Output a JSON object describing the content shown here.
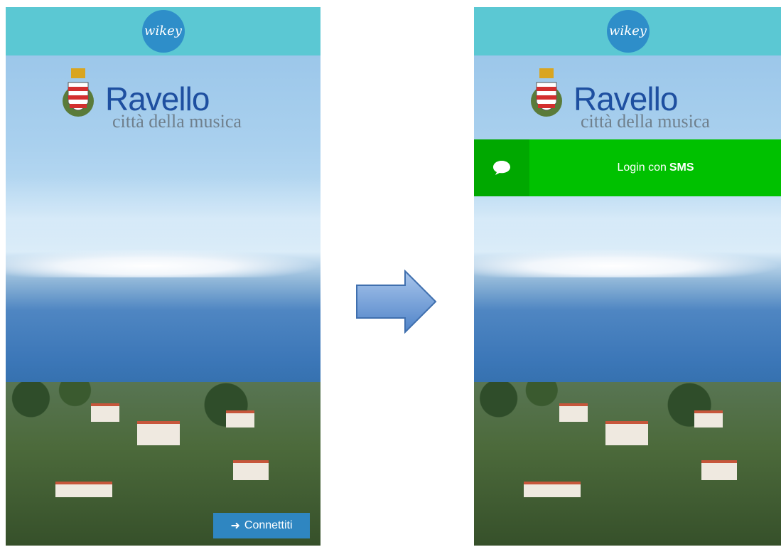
{
  "header": {
    "brand": "wikey"
  },
  "logo": {
    "name": "Ravello",
    "subtitle": "città della musica"
  },
  "left_screen": {
    "connect_label": "Connettiti"
  },
  "right_screen": {
    "sms_prefix": "Login con",
    "sms_bold": "SMS"
  },
  "colors": {
    "topbar": "#5bc8d3",
    "brand_circle": "#2e8ec9",
    "connect_button": "#2f86c1",
    "sms_bar": "#00c100",
    "sms_icon_box": "#00a800",
    "arrow": "#5b8fd0"
  },
  "icons": {
    "connect": "arrow-right-icon",
    "sms": "chat-bubble-icon",
    "transition": "big-right-arrow"
  }
}
